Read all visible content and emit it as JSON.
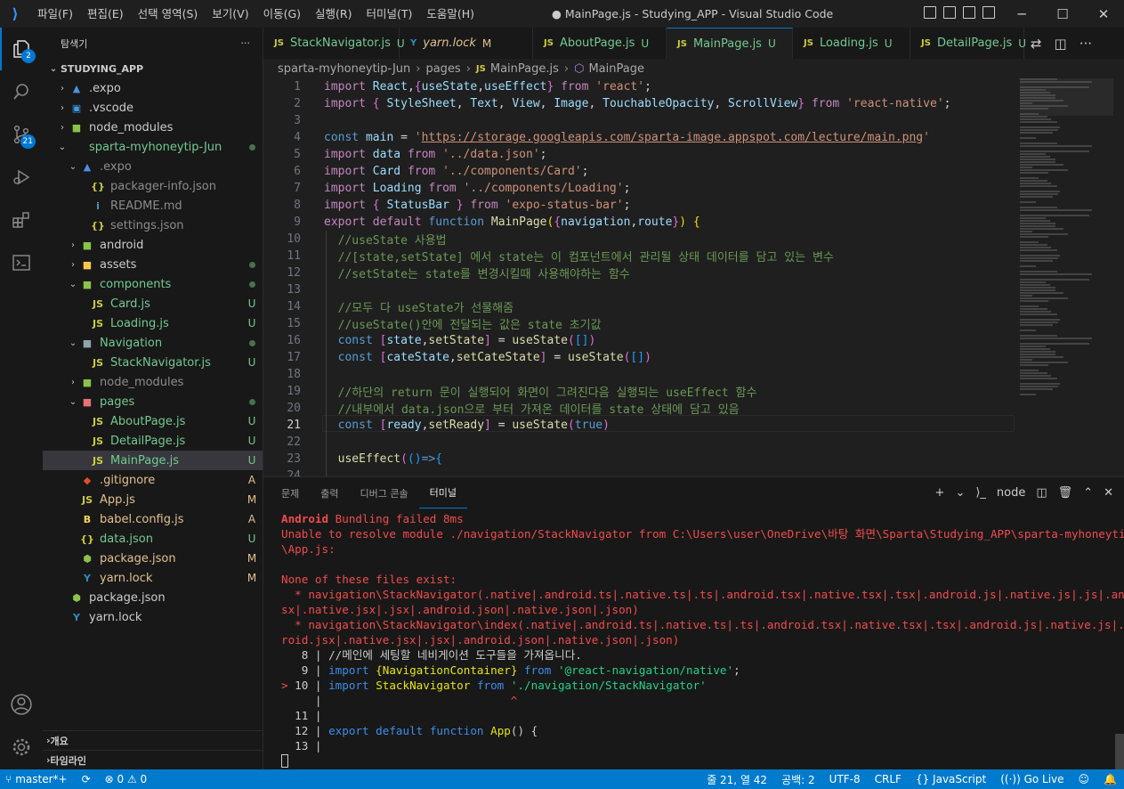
{
  "window": {
    "title": "● MainPage.js - Studying_APP - Visual Studio Code",
    "menu": [
      "파일(F)",
      "편집(E)",
      "선택 영역(S)",
      "보기(V)",
      "이동(G)",
      "실행(R)",
      "터미널(T)",
      "도움말(H)"
    ],
    "controls": {
      "minimize": "─",
      "maximize": "☐",
      "close": "✕"
    }
  },
  "activity": {
    "explorer_badge": "2",
    "scm_badge": "21",
    "icons": [
      "files-icon",
      "search-icon",
      "source-control-icon",
      "run-debug-icon",
      "extensions-icon",
      "remote-explorer-icon",
      "account-icon",
      "gear-icon"
    ]
  },
  "sidebar": {
    "title": "탐색기",
    "more": "···",
    "root": "STUDYING_APP",
    "items": [
      {
        "label": ".expo",
        "depth": 1,
        "chev": "›",
        "icon": "▲",
        "icon_color": "#4f8ee8",
        "status": "",
        "color": "default"
      },
      {
        "label": ".vscode",
        "depth": 1,
        "chev": "›",
        "icon": "▣",
        "icon_color": "#3b9de5",
        "status": "",
        "color": "default"
      },
      {
        "label": "node_modules",
        "depth": 1,
        "chev": "›",
        "icon": "■",
        "icon_color": "#8bc34a",
        "status": "",
        "color": "default"
      },
      {
        "label": "sparta-myhoneytip-Jun",
        "depth": 1,
        "chev": "⌄",
        "icon": "",
        "icon_color": "",
        "status": "dot",
        "color": "green"
      },
      {
        "label": ".expo",
        "depth": 2,
        "chev": "⌄",
        "icon": "▲",
        "icon_color": "#4f8ee8",
        "status": "",
        "color": "gray"
      },
      {
        "label": "packager-info.json",
        "depth": 3,
        "chev": "",
        "icon": "{}",
        "icon_color": "#cbcb41",
        "status": "",
        "color": "gray"
      },
      {
        "label": "README.md",
        "depth": 3,
        "chev": "",
        "icon": "i",
        "icon_color": "#519aba",
        "status": "",
        "color": "gray"
      },
      {
        "label": "settings.json",
        "depth": 3,
        "chev": "",
        "icon": "{}",
        "icon_color": "#cbcb41",
        "status": "",
        "color": "gray"
      },
      {
        "label": "android",
        "depth": 2,
        "chev": "›",
        "icon": "■",
        "icon_color": "#8bc34a",
        "status": "",
        "color": "default"
      },
      {
        "label": "assets",
        "depth": 2,
        "chev": "›",
        "icon": "■",
        "icon_color": "#f9c74f",
        "status": "dot",
        "color": "default"
      },
      {
        "label": "components",
        "depth": 2,
        "chev": "⌄",
        "icon": "■",
        "icon_color": "#8bc34a",
        "status": "dot",
        "color": "green"
      },
      {
        "label": "Card.js",
        "depth": 3,
        "chev": "",
        "icon": "JS",
        "icon_color": "#cbcb41",
        "status": "U",
        "color": "green"
      },
      {
        "label": "Loading.js",
        "depth": 3,
        "chev": "",
        "icon": "JS",
        "icon_color": "#cbcb41",
        "status": "U",
        "color": "green"
      },
      {
        "label": "Navigation",
        "depth": 2,
        "chev": "⌄",
        "icon": "■",
        "icon_color": "#90a4ae",
        "status": "dot",
        "color": "green"
      },
      {
        "label": "StackNavigator.js",
        "depth": 3,
        "chev": "",
        "icon": "JS",
        "icon_color": "#cbcb41",
        "status": "U",
        "color": "green"
      },
      {
        "label": "node_modules",
        "depth": 2,
        "chev": "›",
        "icon": "■",
        "icon_color": "#8bc34a",
        "status": "",
        "color": "gray"
      },
      {
        "label": "pages",
        "depth": 2,
        "chev": "⌄",
        "icon": "■",
        "icon_color": "#e57373",
        "status": "dot",
        "color": "green"
      },
      {
        "label": "AboutPage.js",
        "depth": 3,
        "chev": "",
        "icon": "JS",
        "icon_color": "#cbcb41",
        "status": "U",
        "color": "green"
      },
      {
        "label": "DetailPage.js",
        "depth": 3,
        "chev": "",
        "icon": "JS",
        "icon_color": "#cbcb41",
        "status": "U",
        "color": "green"
      },
      {
        "label": "MainPage.js",
        "depth": 3,
        "chev": "",
        "icon": "JS",
        "icon_color": "#cbcb41",
        "status": "U",
        "color": "green",
        "selected": true
      },
      {
        "label": ".gitignore",
        "depth": 2,
        "chev": "",
        "icon": "◆",
        "icon_color": "#e44d26",
        "status": "A",
        "color": "yellow"
      },
      {
        "label": "App.js",
        "depth": 2,
        "chev": "",
        "icon": "JS",
        "icon_color": "#cbcb41",
        "status": "M",
        "color": "yellow"
      },
      {
        "label": "babel.config.js",
        "depth": 2,
        "chev": "",
        "icon": "B",
        "icon_color": "#f5da55",
        "status": "A",
        "color": "yellow"
      },
      {
        "label": "data.json",
        "depth": 2,
        "chev": "",
        "icon": "{}",
        "icon_color": "#cbcb41",
        "status": "U",
        "color": "green"
      },
      {
        "label": "package.json",
        "depth": 2,
        "chev": "",
        "icon": "⬢",
        "icon_color": "#8bc34a",
        "status": "M",
        "color": "yellow"
      },
      {
        "label": "yarn.lock",
        "depth": 2,
        "chev": "",
        "icon": "Y",
        "icon_color": "#2c8ebb",
        "status": "M",
        "color": "yellow"
      },
      {
        "label": "package.json",
        "depth": 1,
        "chev": "",
        "icon": "⬢",
        "icon_color": "#8bc34a",
        "status": "",
        "color": "default"
      },
      {
        "label": "yarn.lock",
        "depth": 1,
        "chev": "",
        "icon": "Y",
        "icon_color": "#2c8ebb",
        "status": "",
        "color": "default"
      }
    ],
    "outline": "개요",
    "timeline": "타임라인"
  },
  "tabs": [
    {
      "label": "StackNavigator.js",
      "mark": "U",
      "icon": "JS",
      "italic": false,
      "active": false,
      "dirty": false
    },
    {
      "label": "yarn.lock",
      "mark": "M",
      "icon": "Y",
      "italic": true,
      "active": false,
      "dirty": false
    },
    {
      "label": "AboutPage.js",
      "mark": "U",
      "icon": "JS",
      "italic": false,
      "active": false,
      "dirty": false
    },
    {
      "label": "MainPage.js",
      "mark": "U",
      "icon": "JS",
      "italic": false,
      "active": true,
      "dirty": true
    },
    {
      "label": "Loading.js",
      "mark": "U",
      "icon": "JS",
      "italic": false,
      "active": false,
      "dirty": false
    },
    {
      "label": "DetailPage.js",
      "mark": "U",
      "icon": "JS",
      "italic": false,
      "active": false,
      "dirty": false
    }
  ],
  "breadcrumb": {
    "parts": [
      "sparta-myhoneytip-Jun",
      "pages",
      "MainPage.js",
      "MainPage"
    ]
  },
  "editor": {
    "current_line": 21,
    "lines": [
      {
        "n": "1",
        "html": "<span class='k'>import</span> <span class='v'>React</span><span class='p'>,</span><span class='br2'>{</span><span class='v'>useState</span><span class='p'>,</span><span class='v'>useEffect</span><span class='br2'>}</span> <span class='k'>from</span> <span class='s'>'react'</span><span class='p'>;</span>"
      },
      {
        "n": "2",
        "html": "<span class='k'>import</span> <span class='br2'>{</span> <span class='v'>StyleSheet</span><span class='p'>,</span> <span class='v'>Text</span><span class='p'>,</span> <span class='v'>View</span><span class='p'>,</span> <span class='v'>Image</span><span class='p'>,</span> <span class='v'>TouchableOpacity</span><span class='p'>,</span> <span class='v'>ScrollView</span><span class='br2'>}</span> <span class='k'>from</span> <span class='s'>'react-native'</span><span class='p'>;</span>"
      },
      {
        "n": "3",
        "html": ""
      },
      {
        "n": "4",
        "html": "<span class='b'>const</span> <span class='v'>main</span> <span class='p'>=</span> <span class='s'>'</span><span class='u'>https://storage.googleapis.com/sparta-image.appspot.com/lecture/main.png</span><span class='s'>'</span>"
      },
      {
        "n": "5",
        "html": "<span class='k'>import</span> <span class='v'>data</span> <span class='k'>from</span> <span class='s'>'../data.json'</span><span class='p'>;</span>"
      },
      {
        "n": "6",
        "html": "<span class='k'>import</span> <span class='v'>Card</span> <span class='k'>from</span> <span class='s'>'../components/Card'</span><span class='p'>;</span>"
      },
      {
        "n": "7",
        "html": "<span class='k'>import</span> <span class='v'>Loading</span> <span class='k'>from</span> <span class='s'>'../components/Loading'</span><span class='p'>;</span>"
      },
      {
        "n": "8",
        "html": "<span class='k'>import</span> <span class='br2'>{</span> <span class='v'>StatusBar</span> <span class='br2'>}</span> <span class='k'>from</span> <span class='s'>'expo-status-bar'</span><span class='p'>;</span>"
      },
      {
        "n": "9",
        "html": "<span class='k'>export</span> <span class='k'>default</span> <span class='b'>function</span> <span class='f'>MainPage</span><span class='br1'>(</span><span class='br2'>{</span><span class='v'>navigation</span><span class='p'>,</span><span class='v'>route</span><span class='br2'>}</span><span class='br1'>)</span> <span class='br1'>{</span>"
      },
      {
        "n": "10",
        "html": "  <span class='cm'>//useState 사용법</span>"
      },
      {
        "n": "11",
        "html": "  <span class='cm'>//[state,setState] 에서 state는 이 컴포넌트에서 관리될 상태 데이터를 담고 있는 변수</span>"
      },
      {
        "n": "12",
        "html": "  <span class='cm'>//setState는 state를 변경시킬때 사용해야하는 함수</span>"
      },
      {
        "n": "13",
        "html": ""
      },
      {
        "n": "14",
        "html": "  <span class='cm'>//모두 다 useState가 선물해줌</span>"
      },
      {
        "n": "15",
        "html": "  <span class='cm'>//useState()안에 전달되는 값은 state 초기값</span>"
      },
      {
        "n": "16",
        "html": "  <span class='b'>const</span> <span class='br2'>[</span><span class='v'>state</span><span class='p'>,</span><span class='f'>setState</span><span class='br2'>]</span> <span class='p'>=</span> <span class='f'>useState</span><span class='br2'>(</span><span class='br3'>[]</span><span class='br2'>)</span>"
      },
      {
        "n": "17",
        "html": "  <span class='b'>const</span> <span class='br2'>[</span><span class='v'>cateState</span><span class='p'>,</span><span class='f'>setCateState</span><span class='br2'>]</span> <span class='p'>=</span> <span class='f'>useState</span><span class='br2'>(</span><span class='br3'>[]</span><span class='br2'>)</span>"
      },
      {
        "n": "18",
        "html": ""
      },
      {
        "n": "19",
        "html": "  <span class='cm'>//하단의 return 문이 실행되어 화면이 그려진다음 실행되는 useEffect 함수</span>"
      },
      {
        "n": "20",
        "html": "  <span class='cm'>//내부에서 data.json으로 부터 가져온 데이터를 state 상태에 담고 있음</span>"
      },
      {
        "n": "21",
        "html": "  <span class='b'>const</span> <span class='br2'>[</span><span class='v'>ready</span><span class='p'>,</span><span class='f'>setReady</span><span class='br2'>]</span> <span class='p'>=</span> <span class='f'>useState</span><span class='br2'>(</span><span class='b'>true</span><span class='br2'>)</span>"
      },
      {
        "n": "22",
        "html": ""
      },
      {
        "n": "23",
        "html": "  <span class='f'>useEffect</span><span class='br2'>(</span><span class='br3'>()</span><span class='b'>=&gt;</span><span class='br3'>{</span>"
      },
      {
        "n": "24",
        "html": ""
      }
    ]
  },
  "panel": {
    "tabs": [
      "문제",
      "출력",
      "디버그 콘솔",
      "터미널"
    ],
    "active_tab": "터미널",
    "terminal_name": "node",
    "add": "+",
    "chevron": "⌄",
    "split": "◫",
    "trash": "🗑",
    "up": "⌃",
    "close": "✕",
    "lines": [
      "<span class='t-bold'>Android</span> Bundling failed 8ms",
      "Unable to resolve module ./navigation/StackNavigator from C:\\Users\\user\\OneDrive\\바탕 화면\\Sparta\\Studying_APP\\sparta-myhoneytip-Jun",
      "\\App.js:",
      "",
      "None of these files exist:",
      "  * navigation\\StackNavigator(.native|.android.ts|.native.ts|.ts|.android.tsx|.native.tsx|.tsx|.android.js|.native.js|.js|.android.j",
      "sx|.native.jsx|.jsx|.android.json|.native.json|.json)",
      "  * navigation\\StackNavigator\\index(.native|.android.ts|.native.ts|.ts|.android.tsx|.native.tsx|.tsx|.android.js|.native.js|.js|.and",
      "roid.jsx|.native.jsx|.jsx|.android.json|.native.json|.json)",
      "<span class='t-gray'>   8 | //메인에 세팅할 네비게이션 도구들을 가져옵니다.</span>",
      "<span class='t-gray'>   9 | </span><span class='t-blue'>import</span> <span class='t-yel'>{NavigationContainer}</span> <span class='t-blue'>from</span> <span class='t-grn'>'@react-navigation/native'</span><span class='t-gray'>;</span>",
      "<span class='t-caret'>&gt; </span><span class='t-gray'>10 | </span><span class='t-blue'>import</span> <span class='t-yel'>StackNavigator</span> <span class='t-blue'>from</span> <span class='t-grn'>'./navigation/StackNavigator'</span>",
      "<span class='t-gray'>     | </span>                           <span class='t-caret'>^</span>",
      "<span class='t-gray'>  11 |</span>",
      "<span class='t-gray'>  12 | </span><span class='t-blue'>export</span> <span class='t-blue'>default</span> <span class='t-blue'>function</span> <span class='t-yel'>App</span><span class='t-gray'>() {</span>",
      "<span class='t-gray'>  13 |</span>"
    ]
  },
  "statusbar": {
    "branch": "master*+",
    "sync": "⟳",
    "errors": "⊗ 0",
    "warnings": "⚠ 0",
    "position": "줄 21, 열 42",
    "spaces": "공백: 2",
    "encoding": "UTF-8",
    "eol": "CRLF",
    "language": "JavaScript",
    "golive": "Go Live"
  }
}
